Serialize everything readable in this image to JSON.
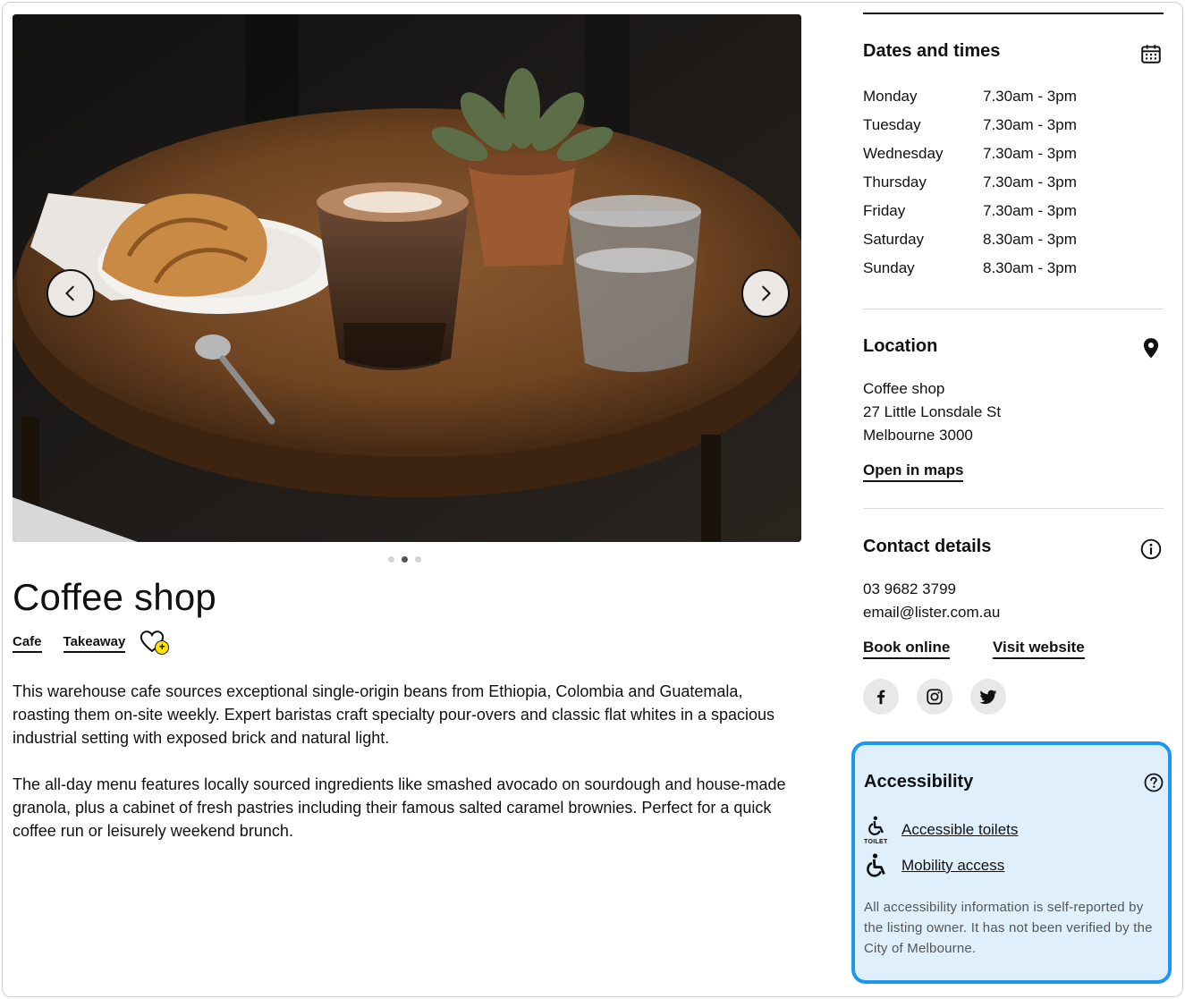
{
  "gallery": {
    "prev_icon": "chevron-left-icon",
    "next_icon": "chevron-right-icon",
    "slide_count": 3,
    "active_slide": 2
  },
  "venue": {
    "title": "Coffee shop",
    "tags": [
      "Cafe",
      "Takeaway"
    ],
    "favourite_icon": "heart-plus-icon",
    "favourite_plus": "+",
    "description": [
      "This warehouse cafe sources exceptional single-origin beans from Ethiopia, Colombia and Guatemala, roasting them on-site weekly. Expert baristas craft specialty pour-overs and classic flat whites in a spacious industrial setting with exposed brick and natural light.",
      "The all-day menu features locally sourced ingredients like smashed avocado on sourdough and house-made granola, plus a cabinet of fresh pastries including their famous salted caramel brownies. Perfect for a quick coffee run or leisurely weekend brunch."
    ]
  },
  "dates": {
    "title": "Dates and times",
    "icon": "calendar-icon",
    "hours": [
      {
        "day": "Monday",
        "time": "7.30am - 3pm"
      },
      {
        "day": "Tuesday",
        "time": "7.30am - 3pm"
      },
      {
        "day": "Wednesday",
        "time": "7.30am - 3pm"
      },
      {
        "day": "Thursday",
        "time": "7.30am - 3pm"
      },
      {
        "day": "Friday",
        "time": "7.30am - 3pm"
      },
      {
        "day": "Saturday",
        "time": "8.30am - 3pm"
      },
      {
        "day": "Sunday",
        "time": "8.30am - 3pm"
      }
    ]
  },
  "location": {
    "title": "Location",
    "icon": "map-pin-icon",
    "lines": [
      "Coffee shop",
      "27 Little Lonsdale St",
      "Melbourne 3000"
    ],
    "maps_link": "Open in maps"
  },
  "contact": {
    "title": "Contact details",
    "icon": "info-icon",
    "phone": "03 9682 3799",
    "email": "email@lister.com.au",
    "book_link": "Book online",
    "website_link": "Visit website",
    "socials": [
      "facebook-icon",
      "instagram-icon",
      "twitter-icon"
    ]
  },
  "accessibility": {
    "title": "Accessibility",
    "help_icon": "help-icon",
    "items": [
      {
        "label": "Accessible toilets",
        "icon": "accessible-toilet-icon",
        "icon_text": "TOILET"
      },
      {
        "label": "Mobility access",
        "icon": "wheelchair-icon"
      }
    ],
    "note": "All accessibility information is self-reported by the listing owner. It has not been verified by the City of Melbourne.",
    "accent": "#1a98f0",
    "background": "#dff0fc"
  }
}
